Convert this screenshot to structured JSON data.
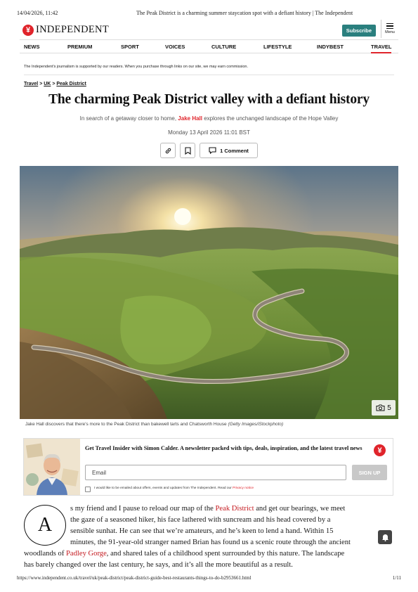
{
  "print_header": {
    "datetime": "14/04/2026, 11:42",
    "title": "The Peak District is a charming summer staycation spot with a defiant history | The Independent"
  },
  "masthead": {
    "logo_glyph": "¥",
    "logo_text": "INDEPENDENT",
    "subscribe": "Subscribe",
    "menu_label": "Menu",
    "logo_color": "#e0242b",
    "subscribe_color": "#2a7f7e"
  },
  "nav": {
    "items": [
      "NEWS",
      "PREMIUM",
      "SPORT",
      "VOICES",
      "CULTURE",
      "LIFESTYLE",
      "INDYBEST",
      "TRAVEL"
    ],
    "active": "TRAVEL"
  },
  "affiliate_notice": "The Independent's journalism is supported by our readers. When you purchase through links on our site, we may earn commission.",
  "breadcrumb": {
    "items": [
      "Travel",
      "UK",
      "Peak District"
    ],
    "separator": ">"
  },
  "article": {
    "headline": "The charming Peak District valley with a defiant history",
    "standfirst_before": "In search of a getaway closer to home, ",
    "author": "Jake Hall",
    "standfirst_after": " explores the unchanged landscape of the Hope Valley",
    "date": "Monday 13 April 2026 11:01 BST",
    "comment_button": "1 Comment",
    "share_icons": [
      "link-icon",
      "bookmark-icon",
      "comment-icon"
    ]
  },
  "hero": {
    "gallery_count": "5",
    "caption": "Jake Hall discovers that there's more to the Peak District than bakewell tarts and Chatsworth House",
    "credit": "(Getty Images/iStockphoto)"
  },
  "newsletter": {
    "title": "Get Travel Insider with Simon Calder. A newsletter packed with tips, deals, inspiration, and the latest travel news",
    "email_placeholder": "Email",
    "signup": "SIGN UP",
    "consent_text": "I would like to be emailed about offers, events and updates from The Independent. Read our ",
    "privacy_link": "Privacy notice"
  },
  "body": {
    "dropcap": "A",
    "line1_a": "s my friend and I pause to reload our map of the ",
    "line1_link": "Peak District",
    "line1_b": " and get our bearings, we meet",
    "line2": "the gaze of a seasoned hiker, his face lathered with suncream and his head covered by a",
    "line3": "sensible sunhat. He can see that we’re amateurs, and he’s keen to lend a hand. Within 15",
    "line4": "minutes, the 91-year-old stranger named Brian has found us a scenic route through the ancient",
    "line5_a": "woodlands of ",
    "line5_link": "Padley Gorge",
    "line5_b": ", and shared tales of a childhood spent surrounded by this nature. The landscape",
    "line6": "has barely changed over the last century, he says, and it’s all the more beautiful as a result."
  },
  "print_footer": {
    "url": "https://www.independent.co.uk/travel/uk/peak-district/peak-district-guide-best-restaurants-things-to-do-b2953661.html",
    "page": "1/11"
  }
}
